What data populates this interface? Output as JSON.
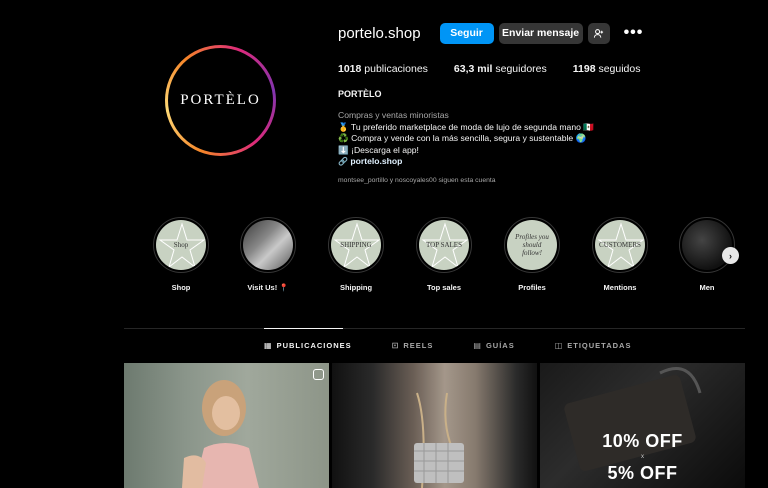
{
  "profile": {
    "username": "portelo.shop",
    "avatar_text": "PORTÈLO",
    "buttons": {
      "follow": "Seguir",
      "message": "Enviar mensaje"
    },
    "stats": [
      {
        "value": "1018",
        "label": "publicaciones"
      },
      {
        "value": "63,3 mil",
        "label": "seguidores"
      },
      {
        "value": "1198",
        "label": "seguidos"
      }
    ],
    "bio": {
      "name": "PORTÈLO",
      "category": "Compras y ventas minoristas",
      "lines": [
        "🥇 Tu preferido marketplace de moda de lujo de segunda mano 🇲🇽",
        "♻️ Compra y vende con la más sencilla, segura y sustentable 🌍",
        "⬇️ ¡Descarga el app!"
      ],
      "link": "portelo.shop"
    },
    "followed_by": "montsee_portillo y noscoyales00 siguen esta cuenta"
  },
  "highlights": [
    {
      "label": "Shop",
      "cover_text": "Shop"
    },
    {
      "label": "Visit Us! 📍",
      "cover_text": ""
    },
    {
      "label": "Shipping",
      "cover_text": "SHIPPING"
    },
    {
      "label": "Top sales",
      "cover_text": "TOP SALES"
    },
    {
      "label": "Profiles",
      "cover_text": "Profiles you should follow!"
    },
    {
      "label": "Mentions",
      "cover_text": "CUSTOMERS"
    },
    {
      "label": "Men",
      "cover_text": ""
    }
  ],
  "tabs": [
    {
      "label": "PUBLICACIONES",
      "icon": "grid-icon",
      "active": true
    },
    {
      "label": "REELS",
      "icon": "reels-icon",
      "active": false
    },
    {
      "label": "GUÍAS",
      "icon": "guides-icon",
      "active": false
    },
    {
      "label": "ETIQUETADAS",
      "icon": "tagged-icon",
      "active": false
    }
  ],
  "posts": [
    {
      "kind": "photo"
    },
    {
      "kind": "photo"
    },
    {
      "kind": "promo",
      "line1": "10% OFF",
      "separator": "x",
      "line2": "5% OFF"
    }
  ],
  "colors": {
    "accent": "#0095f6",
    "background": "#000000",
    "highlight_cover": "#c8d2c2"
  }
}
